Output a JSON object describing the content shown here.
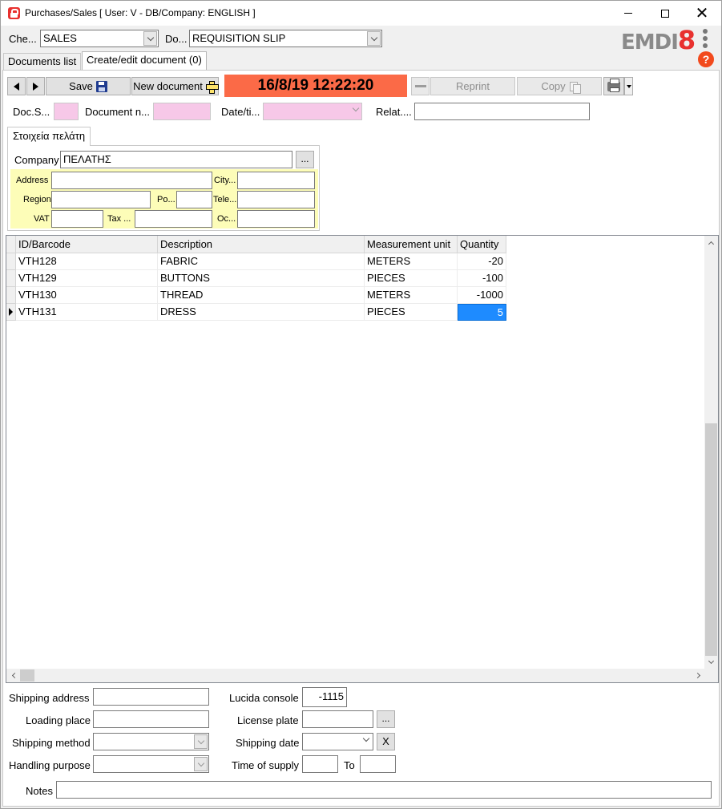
{
  "window": {
    "title": "Purchases/Sales",
    "user_info": "[ User: V - DB/Company: ENGLISH ]"
  },
  "header": {
    "channel_label": "Che...",
    "channel_value": "SALES",
    "doctype_label": "Do...",
    "doctype_value": "REQUISITION SLIP",
    "logo_gray": "EMDI",
    "logo_red": "8",
    "help": "?"
  },
  "tabs": [
    {
      "label": "Documents list"
    },
    {
      "label": "Create/edit document (0)"
    }
  ],
  "toolbar": {
    "save_label": "Save",
    "new_doc_label": "New document",
    "datetime": "16/8/19 12:22:20",
    "reprint_label": "Reprint",
    "copy_label": "Copy"
  },
  "doc_fields": {
    "series_label": "Doc.S...",
    "number_label": "Document n...",
    "datetime_label": "Date/ti...",
    "related_label": "Relat...."
  },
  "customer": {
    "group_title": "Στοιχεία πελάτη",
    "company_label": "Company",
    "company_value": "ΠΕΛΑΤΗΣ",
    "dots": "...",
    "address_label": "Address",
    "city_label": "City...",
    "region_label": "Region",
    "postal_label": "Po...",
    "phone_label": "Tele...",
    "vat_label": "VAT",
    "tax_label": "Tax ...",
    "occupation_label": "Oc..."
  },
  "grid": {
    "columns": [
      "ID/Barcode",
      "Description",
      "Measurement unit",
      "Quantity"
    ],
    "rows": [
      {
        "id": "VTH128",
        "description": "FABRIC",
        "unit": "METERS",
        "quantity": "-20"
      },
      {
        "id": "VTH129",
        "description": "BUTTONS",
        "unit": "PIECES",
        "quantity": "-100"
      },
      {
        "id": "VTH130",
        "description": "THREAD",
        "unit": "METERS",
        "quantity": "-1000"
      },
      {
        "id": "VTH131",
        "description": "DRESS",
        "unit": "PIECES",
        "quantity": "5"
      }
    ]
  },
  "bottom": {
    "shipping_address_label": "Shipping address",
    "loading_place_label": "Loading place",
    "shipping_method_label": "Shipping method",
    "handling_purpose_label": "Handling purpose",
    "lucida_label": "Lucida console",
    "lucida_value": "-1115",
    "license_plate_label": "License plate",
    "dots": "...",
    "shipping_date_label": "Shipping date",
    "clear_label": "X",
    "time_of_supply_label": "Time of supply",
    "to_label": "To",
    "notes_label": "Notes"
  }
}
